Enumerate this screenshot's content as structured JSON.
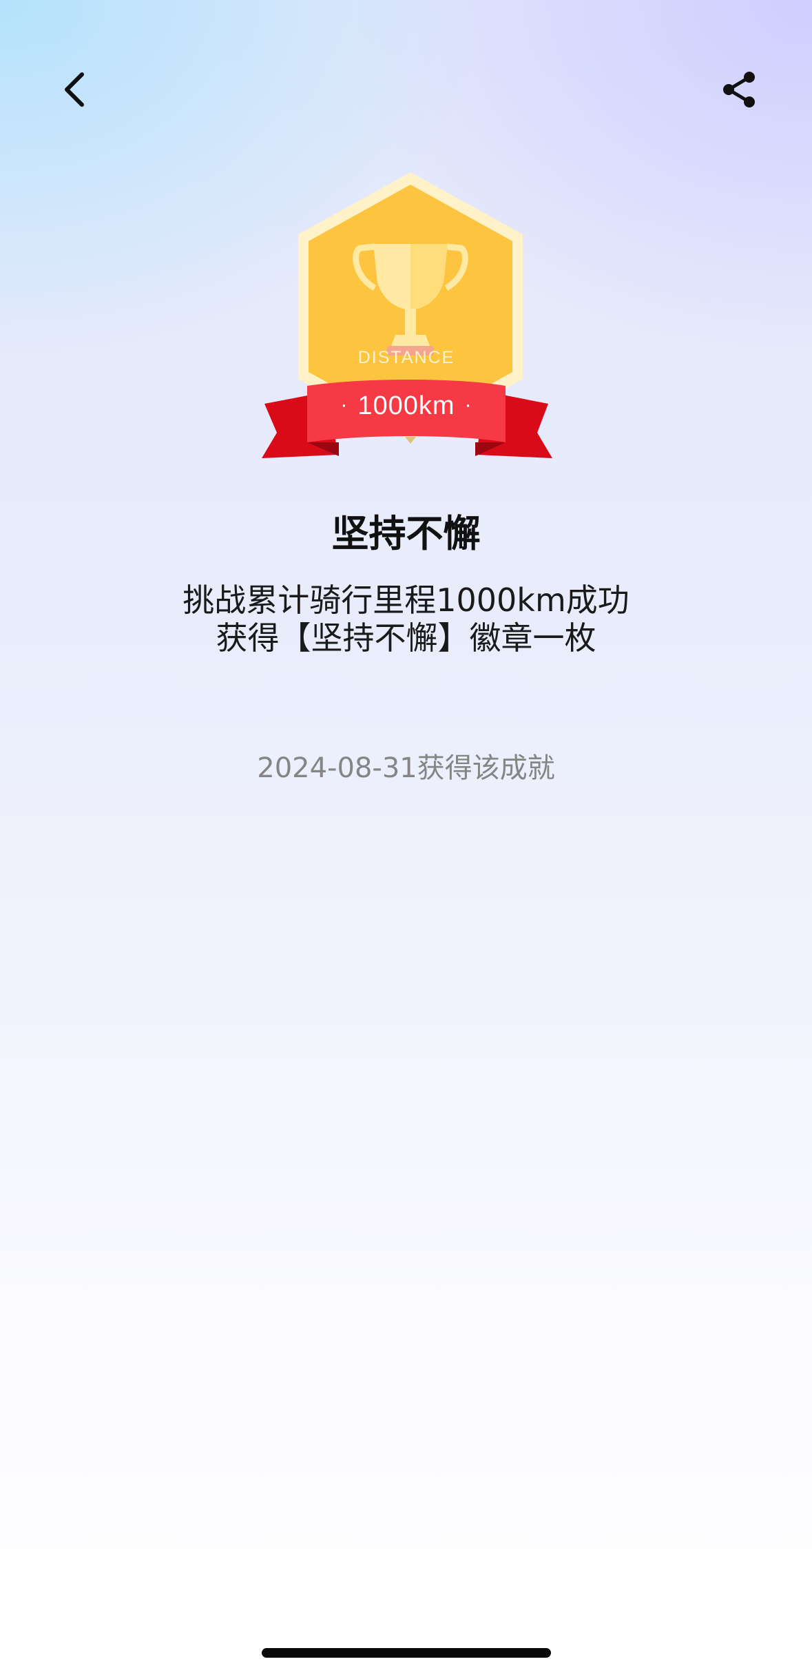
{
  "icons": {
    "back": "chevron-left-icon",
    "share": "share-icon",
    "trophy": "trophy-icon"
  },
  "colors": {
    "badge_gold": "#FDC43F",
    "badge_border": "#FFF2C8",
    "ribbon_red": "#F53A45",
    "ribbon_dark": "#D90B18",
    "date_gray": "#858585"
  },
  "badge": {
    "category": "DISTANCE",
    "dot": "·",
    "value": "1000km"
  },
  "achievement": {
    "title": "坚持不懈",
    "description_line1": "挑战累计骑行里程1000km成功",
    "description_line2": "获得【坚持不懈】徽章一枚",
    "earned_date_text": "2024-08-31获得该成就"
  }
}
